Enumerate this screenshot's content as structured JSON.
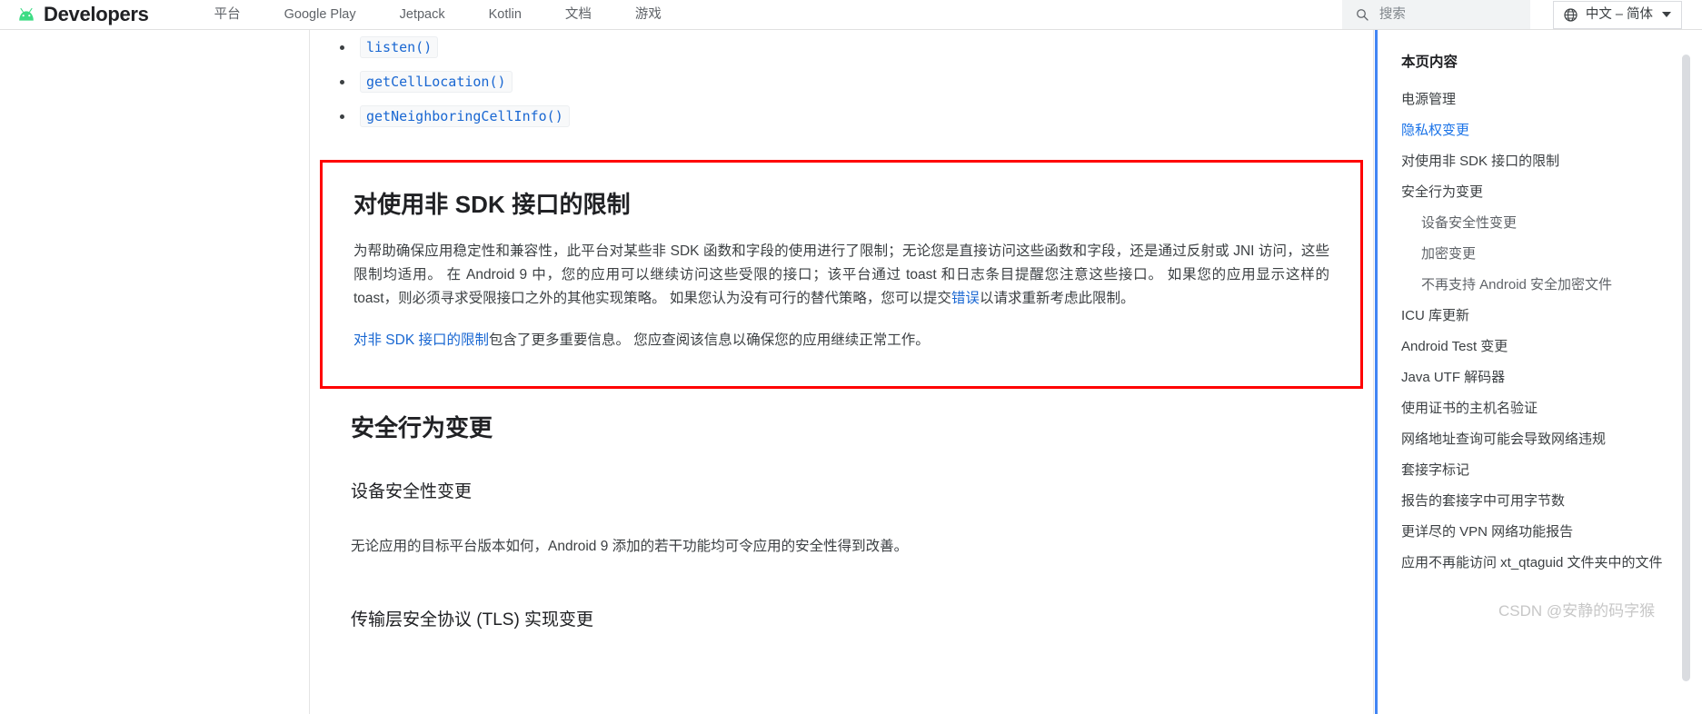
{
  "header": {
    "brand": "Developers",
    "brand_icon": "android-robot-icon",
    "nav": [
      {
        "label": "平台"
      },
      {
        "label": "Google Play"
      },
      {
        "label": "Jetpack"
      },
      {
        "label": "Kotlin"
      },
      {
        "label": "文档"
      },
      {
        "label": "游戏"
      }
    ],
    "search": {
      "icon": "search-icon",
      "placeholder": "搜索",
      "value": ""
    },
    "language": {
      "icon": "globe-icon",
      "label": "中文 – 简体",
      "caret": "chevron-down-icon"
    }
  },
  "main": {
    "code_items": [
      {
        "label": "listen()"
      },
      {
        "label": "getCellLocation()"
      },
      {
        "label": "getNeighboringCellInfo()"
      }
    ],
    "highlight": {
      "border_color": "#ff0000",
      "heading": "对使用非 SDK 接口的限制",
      "paragraph1_a": "为帮助确保应用稳定性和兼容性，此平台对某些非 SDK 函数和字段的使用进行了限制；无论您是直接访问这些函数和字段，还是通过反射或 JNI 访问，这些限制均适用。 在 Android 9 中，您的应用可以继续访问这些受限的接口；该平台通过 toast 和日志条目提醒您注意这些接口。 如果您的应用显示这样的 toast，则必须寻求受限接口之外的其他实现策略。 如果您认为没有可行的替代策略，您可以提交",
      "paragraph1_link": "错误",
      "paragraph1_b": "以请求重新考虑此限制。",
      "paragraph2_link": "对非 SDK 接口的限制",
      "paragraph2_b": "包含了更多重要信息。 您应查阅该信息以确保您的应用继续正常工作。"
    },
    "section2": {
      "heading": "安全行为变更",
      "sub1": "设备安全性变更",
      "para1": "无论应用的目标平台版本如何，Android 9 添加的若干功能均可令应用的安全性得到改善。",
      "sub2": "传输层安全协议 (TLS) 实现变更"
    }
  },
  "toc": {
    "title": "本页内容",
    "items": [
      {
        "label": "电源管理",
        "level": 1,
        "active": false
      },
      {
        "label": "隐私权变更",
        "level": 1,
        "active": true
      },
      {
        "label": "对使用非 SDK 接口的限制",
        "level": 1,
        "active": false
      },
      {
        "label": "安全行为变更",
        "level": 1,
        "active": false
      },
      {
        "label": "设备安全性变更",
        "level": 2,
        "active": false
      },
      {
        "label": "加密变更",
        "level": 2,
        "active": false
      },
      {
        "label": "不再支持 Android 安全加密文件",
        "level": 2,
        "active": false
      },
      {
        "label": "ICU 库更新",
        "level": 1,
        "active": false
      },
      {
        "label": "Android Test 变更",
        "level": 1,
        "active": false
      },
      {
        "label": "Java UTF 解码器",
        "level": 1,
        "active": false
      },
      {
        "label": "使用证书的主机名验证",
        "level": 1,
        "active": false
      },
      {
        "label": "网络地址查询可能会导致网络违规",
        "level": 1,
        "active": false
      },
      {
        "label": "套接字标记",
        "level": 1,
        "active": false
      },
      {
        "label": "报告的套接字中可用字节数",
        "level": 1,
        "active": false
      },
      {
        "label": "更详尽的 VPN 网络功能报告",
        "level": 1,
        "active": false
      },
      {
        "label": "应用不再能访问 xt_qtaguid 文件夹中的文件",
        "level": 1,
        "active": false
      }
    ],
    "accent_color": "#4285f4"
  },
  "watermark": "CSDN @安静的码字猴"
}
